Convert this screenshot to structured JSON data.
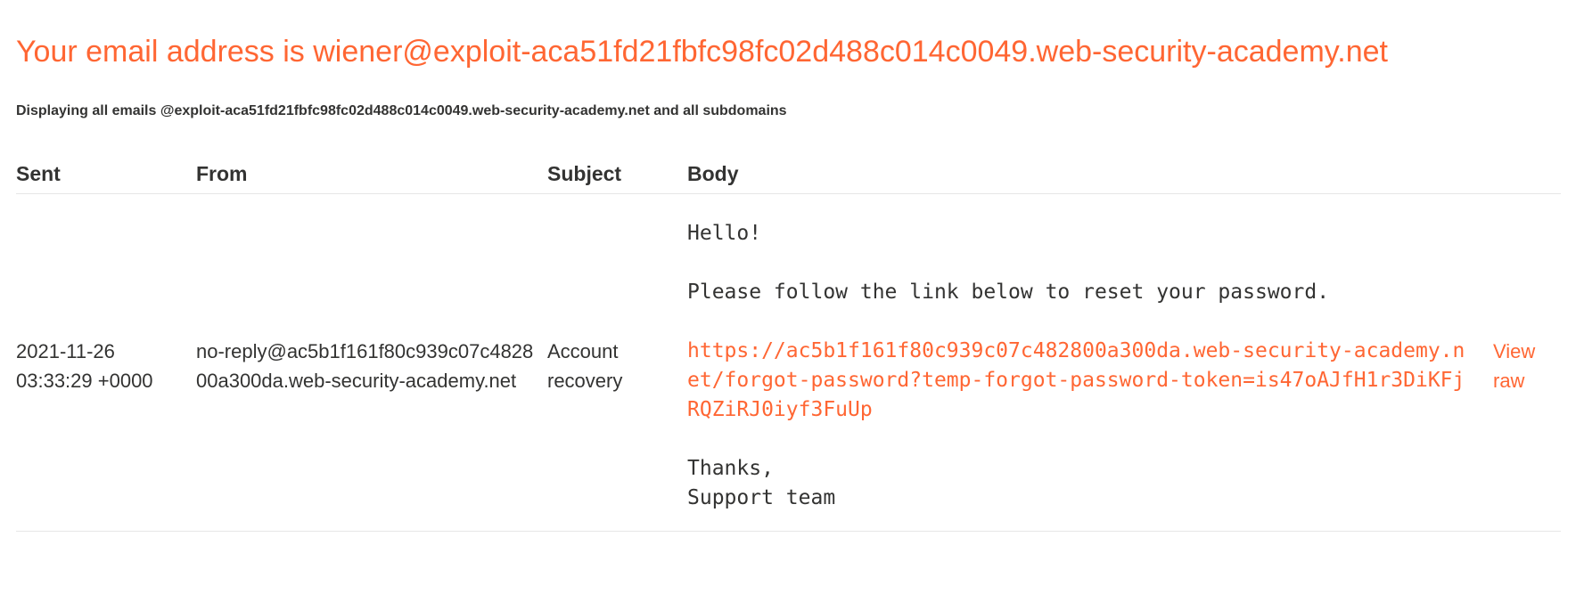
{
  "header": {
    "title": "Your email address is wiener@exploit-aca51fd21fbfc98fc02d488c014c0049.web-security-academy.net",
    "subtitle": "Displaying all emails @exploit-aca51fd21fbfc98fc02d488c014c0049.web-security-academy.net and all subdomains"
  },
  "table": {
    "headers": {
      "sent": "Sent",
      "from": "From",
      "subject": "Subject",
      "body": "Body"
    },
    "rows": [
      {
        "sent": "2021-11-26 03:33:29 +0000",
        "from": "no-reply@ac5b1f161f80c939c07c482800a300da.web-security-academy.net",
        "subject": "Account recovery",
        "body_greeting": "Hello!",
        "body_instruction": "Please follow the link below to reset your password.",
        "body_link": "https://ac5b1f161f80c939c07c482800a300da.web-security-academy.net/forgot-password?temp-forgot-password-token=is47oAJfH1r3DiKFjRQZiRJ0iyf3FuUp",
        "body_thanks": "Thanks,",
        "body_signature": "Support team",
        "view_raw_label": "View raw"
      }
    ]
  },
  "colors": {
    "accent": "#ff6633",
    "text": "#333332",
    "divider": "#e6e6e6"
  }
}
